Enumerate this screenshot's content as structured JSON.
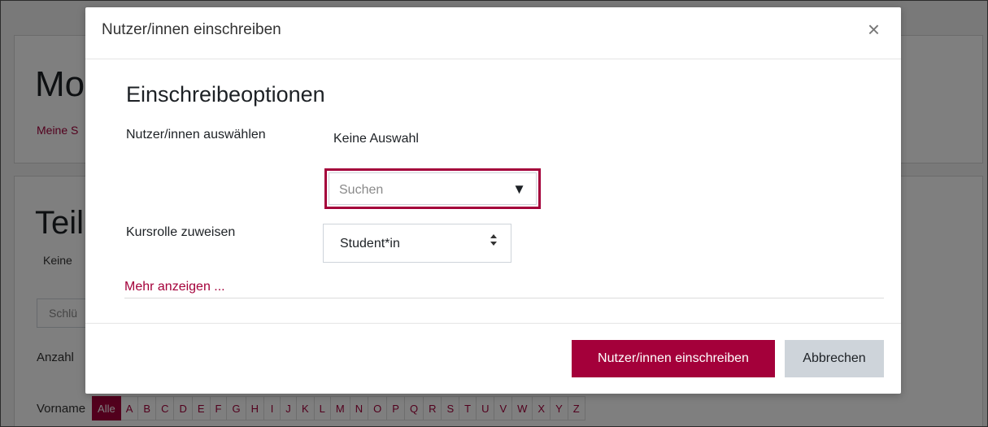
{
  "background": {
    "course_title_fragment": "Mo",
    "breadcrumb_fragment": "Meine S",
    "participants_title_fragment": "Teiln",
    "filter_fragment": "Keine",
    "keyword_placeholder_fragment": "Schlü",
    "count_fragment": "Anzahl",
    "alphabet_label": "Vorname",
    "alphabet": [
      "Alle",
      "A",
      "B",
      "C",
      "D",
      "E",
      "F",
      "G",
      "H",
      "I",
      "J",
      "K",
      "L",
      "M",
      "N",
      "O",
      "P",
      "Q",
      "R",
      "S",
      "T",
      "U",
      "V",
      "W",
      "X",
      "Y",
      "Z"
    ]
  },
  "modal": {
    "title": "Nutzer/innen einschreiben",
    "close_symbol": "×",
    "section_title": "Einschreibeoptionen",
    "select_users_label": "Nutzer/innen auswählen",
    "select_users_value": "Keine Auswahl",
    "search_placeholder": "Suchen",
    "search_arrow": "▼",
    "role_label": "Kursrolle zuweisen",
    "role_value": "Student*in",
    "role_arrow": "⇕",
    "more_link": "Mehr anzeigen ...",
    "primary_button": "Nutzer/innen einschreiben",
    "cancel_button": "Abbrechen"
  },
  "colors": {
    "accent": "#a4003a",
    "highlight_border": "#a4003a",
    "secondary_button": "#ced4da"
  }
}
